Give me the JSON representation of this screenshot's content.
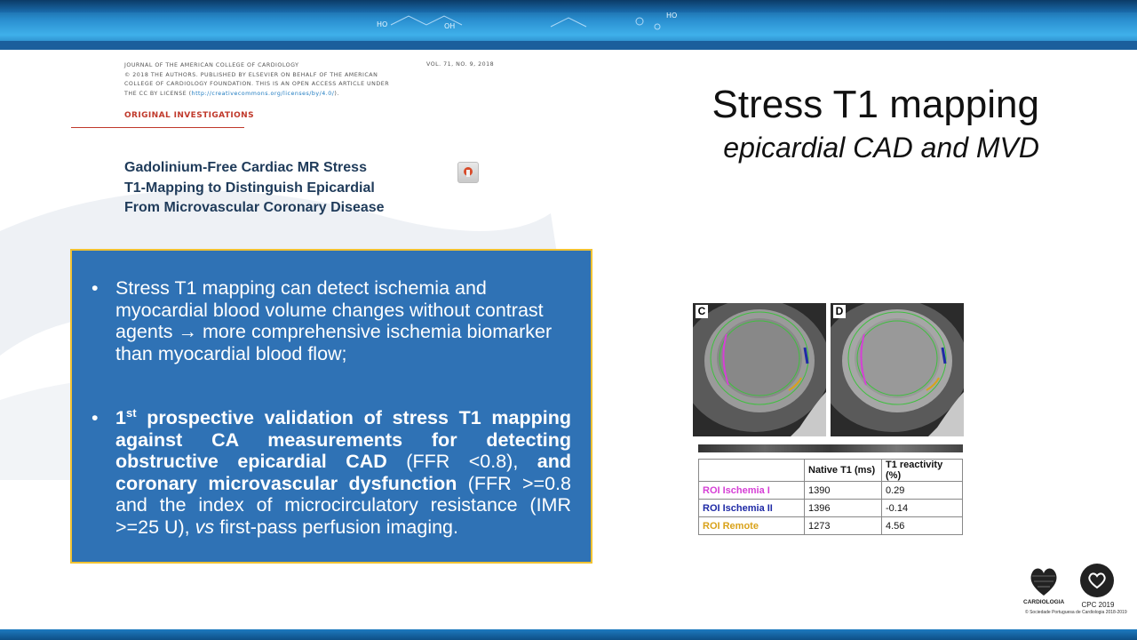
{
  "colors": {
    "accent_blue": "#2f72b5",
    "box_border": "#f1c232",
    "section_red": "#c0392b",
    "title_navy": "#1f3b5a"
  },
  "banner": {
    "chem_labels": [
      "HO",
      "OH",
      "HO"
    ]
  },
  "article": {
    "journal_lines": [
      "JOURNAL OF THE AMERICAN COLLEGE OF CARDIOLOGY",
      "© 2018 THE AUTHORS. PUBLISHED BY ELSEVIER ON BEHALF OF THE AMERICAN",
      "COLLEGE OF CARDIOLOGY FOUNDATION. THIS IS AN OPEN ACCESS ARTICLE UNDER",
      "THE CC BY LICENSE ("
    ],
    "license_url": "http://creativecommons.org/licenses/by/4.0/",
    "license_close": ").",
    "volume": "VOL. 71, NO. 9, 2018",
    "section": "ORIGINAL INVESTIGATIONS",
    "title_lines": [
      "Gadolinium-Free Cardiac MR Stress",
      "T1-Mapping to Distinguish Epicardial",
      "From Microvascular Coronary Disease"
    ],
    "crossmark_icon": "crossmark-icon"
  },
  "slide": {
    "title": "Stress T1 mapping",
    "subtitle": "epicardial CAD and MVD"
  },
  "bullets": {
    "b1": "Stress T1 mapping can detect ischemia and myocardial blood volume changes without contrast agents → more comprehensive ischemia biomarker than myocardial blood flow;",
    "b2": {
      "p1": "1",
      "p1_sup": "st",
      "p2": " prospective validation of stress T1 mapping against CA measurements for detecting obstructive epicardial CAD",
      "p3": " (FFR <0.8), ",
      "p4": "and coronary microvascular dysfunction",
      "p5": " (FFR >=0.8 and the index of microcirculatory resistance (IMR >=25 U), ",
      "p6": "vs",
      "p7": " first-pass perfusion imaging."
    }
  },
  "figure": {
    "panels": [
      "C",
      "D"
    ],
    "table": {
      "headers": [
        "",
        "Native T1 (ms)",
        "T1 reactivity (%)"
      ],
      "rows": [
        {
          "roi": "ROI Ischemia I",
          "color": "#d63fd6",
          "native_t1": "1390",
          "reactivity": "0.29"
        },
        {
          "roi": "ROI Ischemia II",
          "color": "#1f2aa6",
          "native_t1": "1396",
          "reactivity": "-0.14"
        },
        {
          "roi": "ROI Remote",
          "color": "#d9a21a",
          "native_t1": "1273",
          "reactivity": "4.56"
        }
      ]
    }
  },
  "logos": {
    "spc_name": "CARDIOLOGIA",
    "cpc_label": "CPC 2019",
    "copyright": "© Sociedade Portuguesa de Cardiologia 2018-2019"
  }
}
